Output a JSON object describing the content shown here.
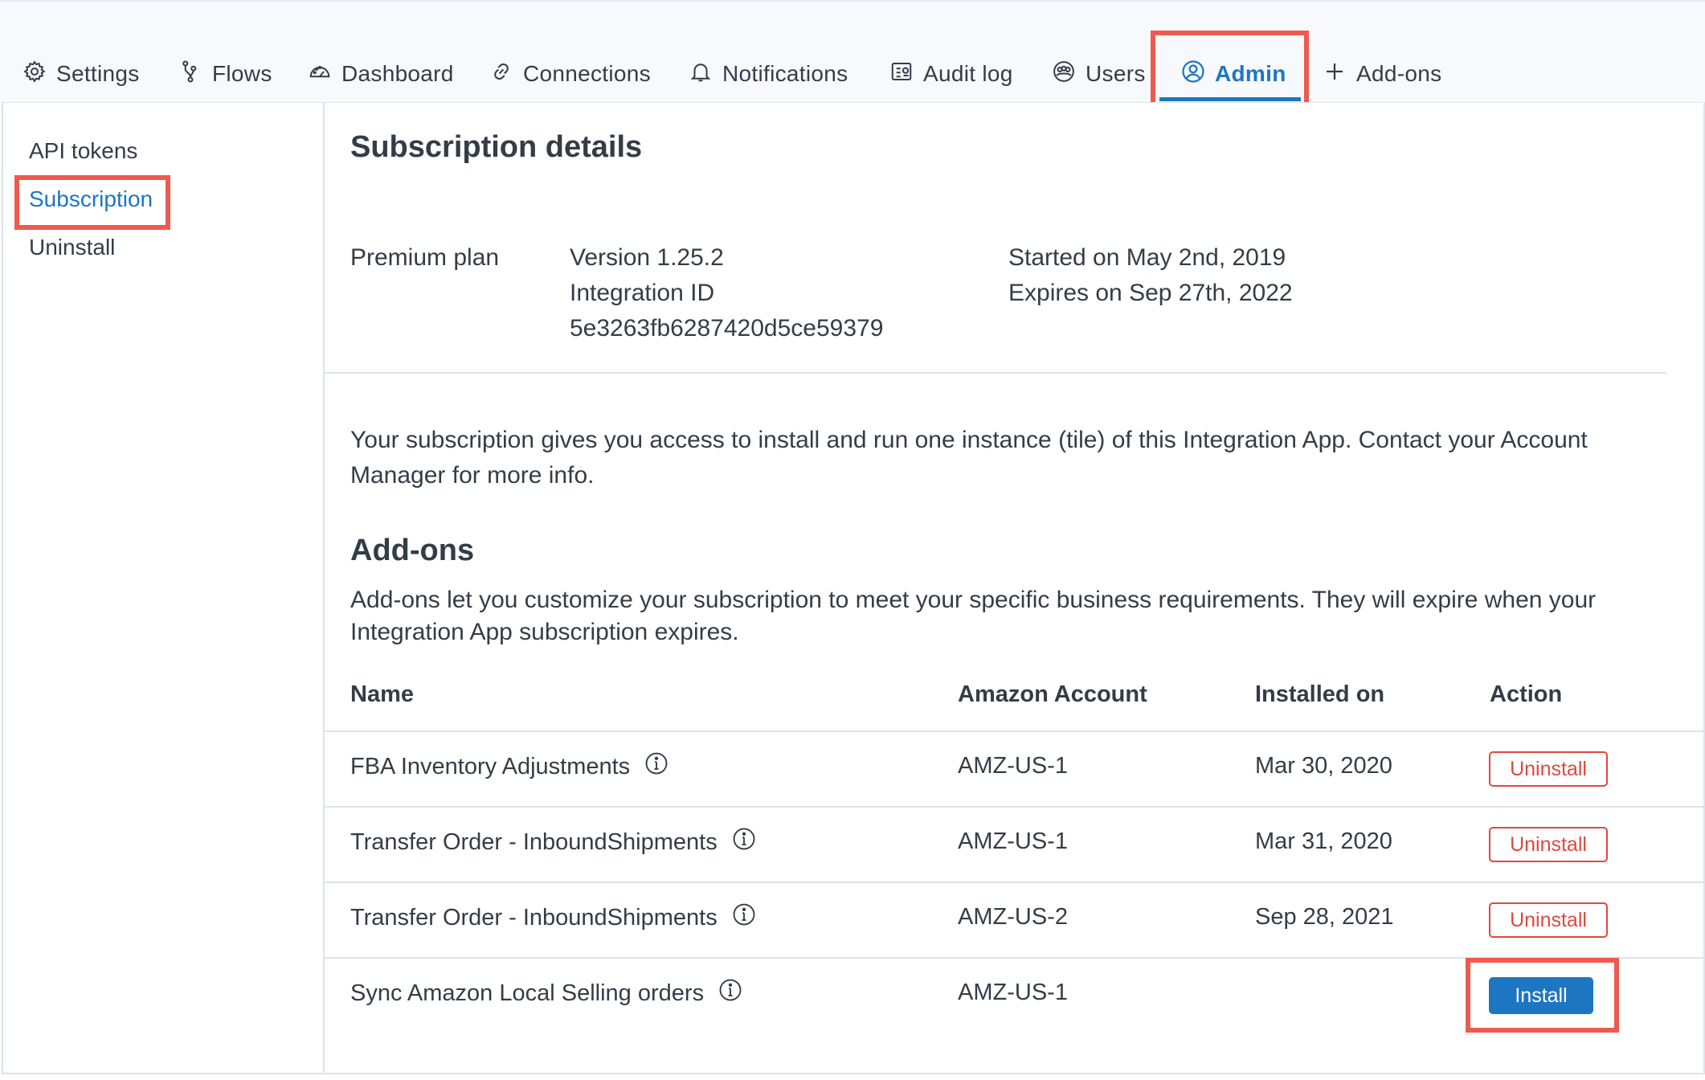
{
  "tabs": [
    {
      "label": "Settings",
      "icon": "gear-icon"
    },
    {
      "label": "Flows",
      "icon": "flows-icon"
    },
    {
      "label": "Dashboard",
      "icon": "gauge-icon"
    },
    {
      "label": "Connections",
      "icon": "link-icon"
    },
    {
      "label": "Notifications",
      "icon": "bell-icon"
    },
    {
      "label": "Audit log",
      "icon": "audit-log-icon"
    },
    {
      "label": "Users",
      "icon": "users-icon"
    },
    {
      "label": "Admin",
      "icon": "user-circle-icon",
      "active": true
    },
    {
      "label": "Add-ons",
      "icon": "plus-icon"
    }
  ],
  "sidebar": {
    "items": [
      {
        "label": "API tokens"
      },
      {
        "label": "Subscription",
        "active": true
      },
      {
        "label": "Uninstall"
      }
    ]
  },
  "subscription": {
    "title": "Subscription details",
    "plan": "Premium plan",
    "version": "Version 1.25.2",
    "integration_id_label": "Integration ID",
    "integration_id": "5e3263fb6287420d5ce59379",
    "started": "Started on May 2nd, 2019",
    "expires": "Expires on Sep 27th, 2022",
    "info": "Your subscription gives you access to install and run one instance (tile) of this Integration App. Contact your Account Manager for more info."
  },
  "addons": {
    "title": "Add-ons",
    "description": "Add-ons let you customize your subscription to meet your specific business requirements. They will expire when your Integration App subscription expires.",
    "columns": [
      "Name",
      "Amazon Account",
      "Installed on",
      "Action"
    ],
    "rows": [
      {
        "name": "FBA Inventory Adjustments",
        "account": "AMZ-US-1",
        "installed_on": "Mar 30, 2020",
        "action": "Uninstall"
      },
      {
        "name": "Transfer Order - InboundShipments",
        "account": "AMZ-US-1",
        "installed_on": "Mar 31, 2020",
        "action": "Uninstall"
      },
      {
        "name": "Transfer Order - InboundShipments",
        "account": "AMZ-US-2",
        "installed_on": "Sep 28, 2021",
        "action": "Uninstall"
      },
      {
        "name": "Sync Amazon Local Selling orders",
        "account": "AMZ-US-1",
        "installed_on": "",
        "action": "Install"
      }
    ]
  },
  "colors": {
    "accent": "#1d76c2",
    "highlight": "#ee5a4f",
    "danger": "#e0483e",
    "text": "#333d47",
    "border": "#dde3ea"
  }
}
